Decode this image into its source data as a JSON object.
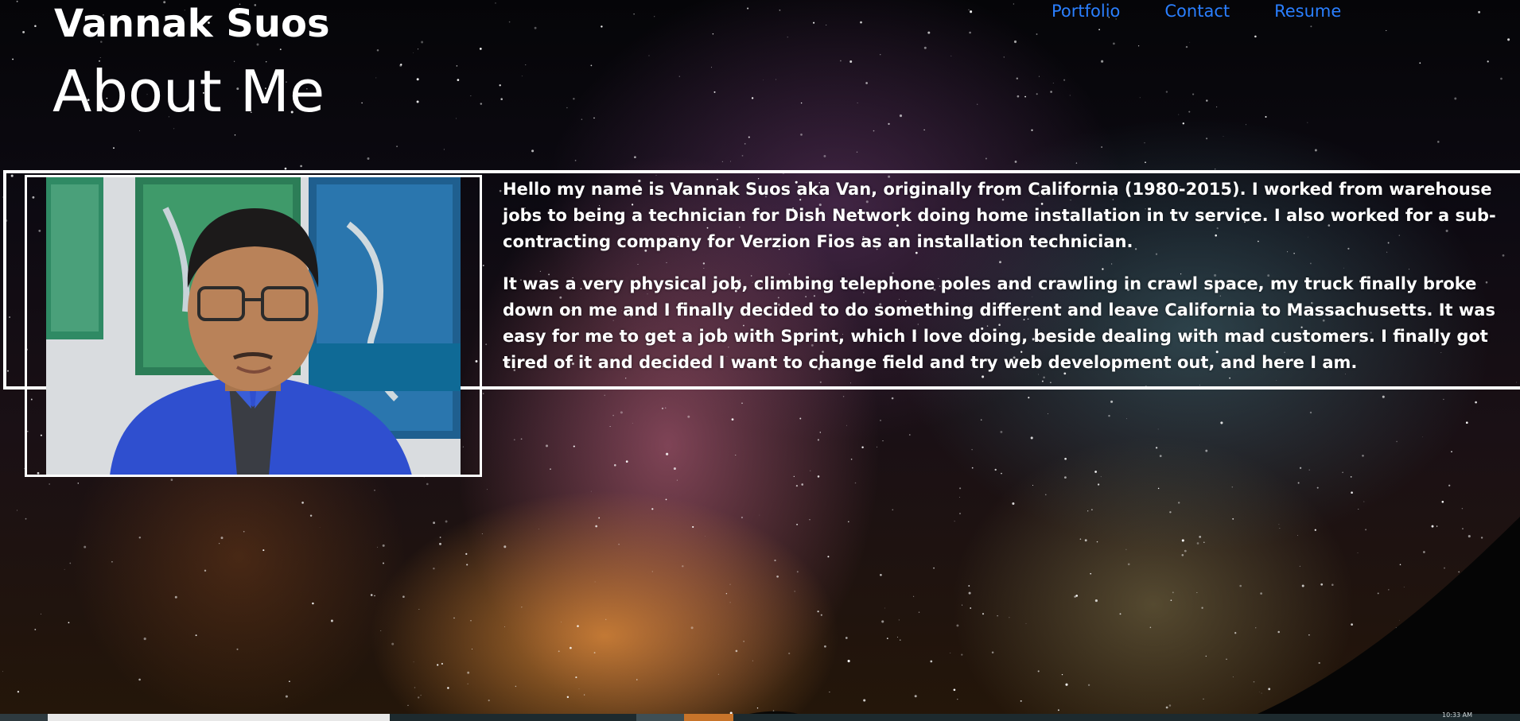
{
  "header": {
    "site_title": "Vannak Suos",
    "page_heading": "About Me"
  },
  "nav": {
    "items": [
      {
        "label": "Portfolio"
      },
      {
        "label": "Contact"
      },
      {
        "label": "Resume"
      }
    ]
  },
  "about": {
    "paragraphs": [
      "Hello my name is Vannak Suos aka Van, originally from California (1980-2015). I worked from warehouse jobs to being a technician for Dish Network doing home installation in tv service. I also worked for a sub-contracting company for Verzion Fios as an installation technician.",
      "It was a very physical job, climbing telephone poles and crawling in crawl space, my truck finally broke down on me and I finally decided to do something different and leave California to Massachusetts. It was easy for me to get a job with Sprint, which I love doing, beside dealing with mad customers. I finally got tired of it and decided I want to change field and try web development out, and here I am."
    ]
  },
  "taskbar": {
    "clock": "10:33 AM"
  },
  "colors": {
    "nav_link": "#2a7fff",
    "text": "#ffffff",
    "frame": "#ffffff",
    "shirt": "#2f4fcf"
  }
}
